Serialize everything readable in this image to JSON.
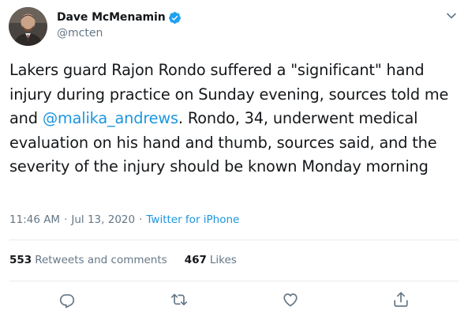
{
  "author": {
    "display_name": "Dave McMenamin",
    "handle": "@mcten",
    "verified": true,
    "avatar_icon": "avatar-photo"
  },
  "tweet": {
    "text_before_mention": "Lakers guard Rajon Rondo suffered a \"significant\" hand injury during practice on Sunday evening, sources told me and ",
    "mention": "@malika_andrews",
    "text_after_mention": ". Rondo, 34, underwent medical evaluation on his hand and thumb, sources said, and the severity of the injury should be known Monday morning"
  },
  "meta": {
    "time": "11:46 AM",
    "separator": "·",
    "date": "Jul 13, 2020",
    "source": "Twitter for iPhone"
  },
  "stats": {
    "retweets_count": "553",
    "retweets_label": "Retweets and comments",
    "likes_count": "467",
    "likes_label": "Likes"
  },
  "actions": {
    "reply_icon": "reply-icon",
    "retweet_icon": "retweet-icon",
    "like_icon": "heart-icon",
    "share_icon": "share-icon"
  },
  "colors": {
    "link": "#1b95e0",
    "secondary_text": "#657786",
    "primary_text": "#14171a",
    "verified_badge": "#1da1f2",
    "divider": "#e6ecf0"
  }
}
